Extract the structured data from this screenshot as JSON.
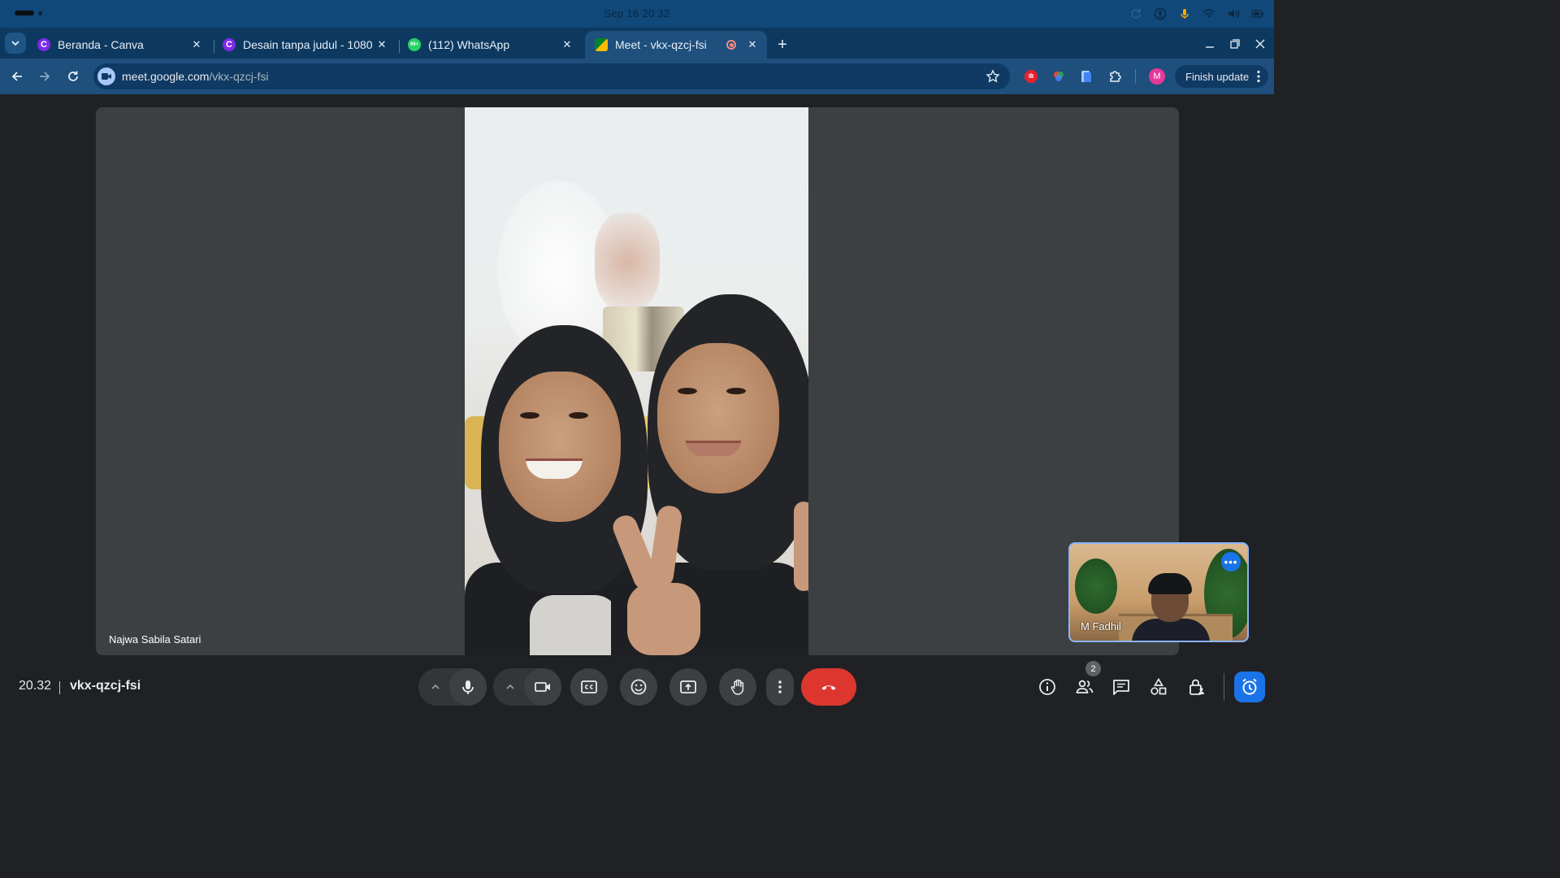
{
  "system": {
    "clock": "Sep 16  20:32",
    "icons": [
      "sync-icon",
      "accessibility-icon",
      "microphone-icon",
      "wifi-icon",
      "volume-icon",
      "battery-icon"
    ]
  },
  "tabs": [
    {
      "title": "Beranda - Canva",
      "favicon": "C",
      "favicon_color": "#7d2ae8",
      "active": false
    },
    {
      "title": "Desain tanpa judul - 1080",
      "favicon": "C",
      "favicon_color": "#7d2ae8",
      "active": false
    },
    {
      "title": "(112) WhatsApp",
      "favicon": "99+",
      "favicon_color": "#25d366",
      "active": false
    },
    {
      "title": "Meet - vkx-qzcj-fsi",
      "favicon": "meet",
      "favicon_color": "#00832d",
      "active": true
    }
  ],
  "address_bar": {
    "host": "meet.google.com",
    "path": "/vkx-qzcj-fsi"
  },
  "profile": {
    "initial": "M"
  },
  "finish_update_label": "Finish update",
  "meeting": {
    "main_participant": "Najwa Sabila Satari",
    "self_name": "M Fadhil",
    "time": "20.32",
    "code": "vkx-qzcj-fsi",
    "participant_count": "2"
  },
  "colors": {
    "accent": "#1a73e8",
    "end_call": "#dc362e",
    "tab_strip": "#0d3960",
    "toolbar": "#1e4f7d"
  }
}
